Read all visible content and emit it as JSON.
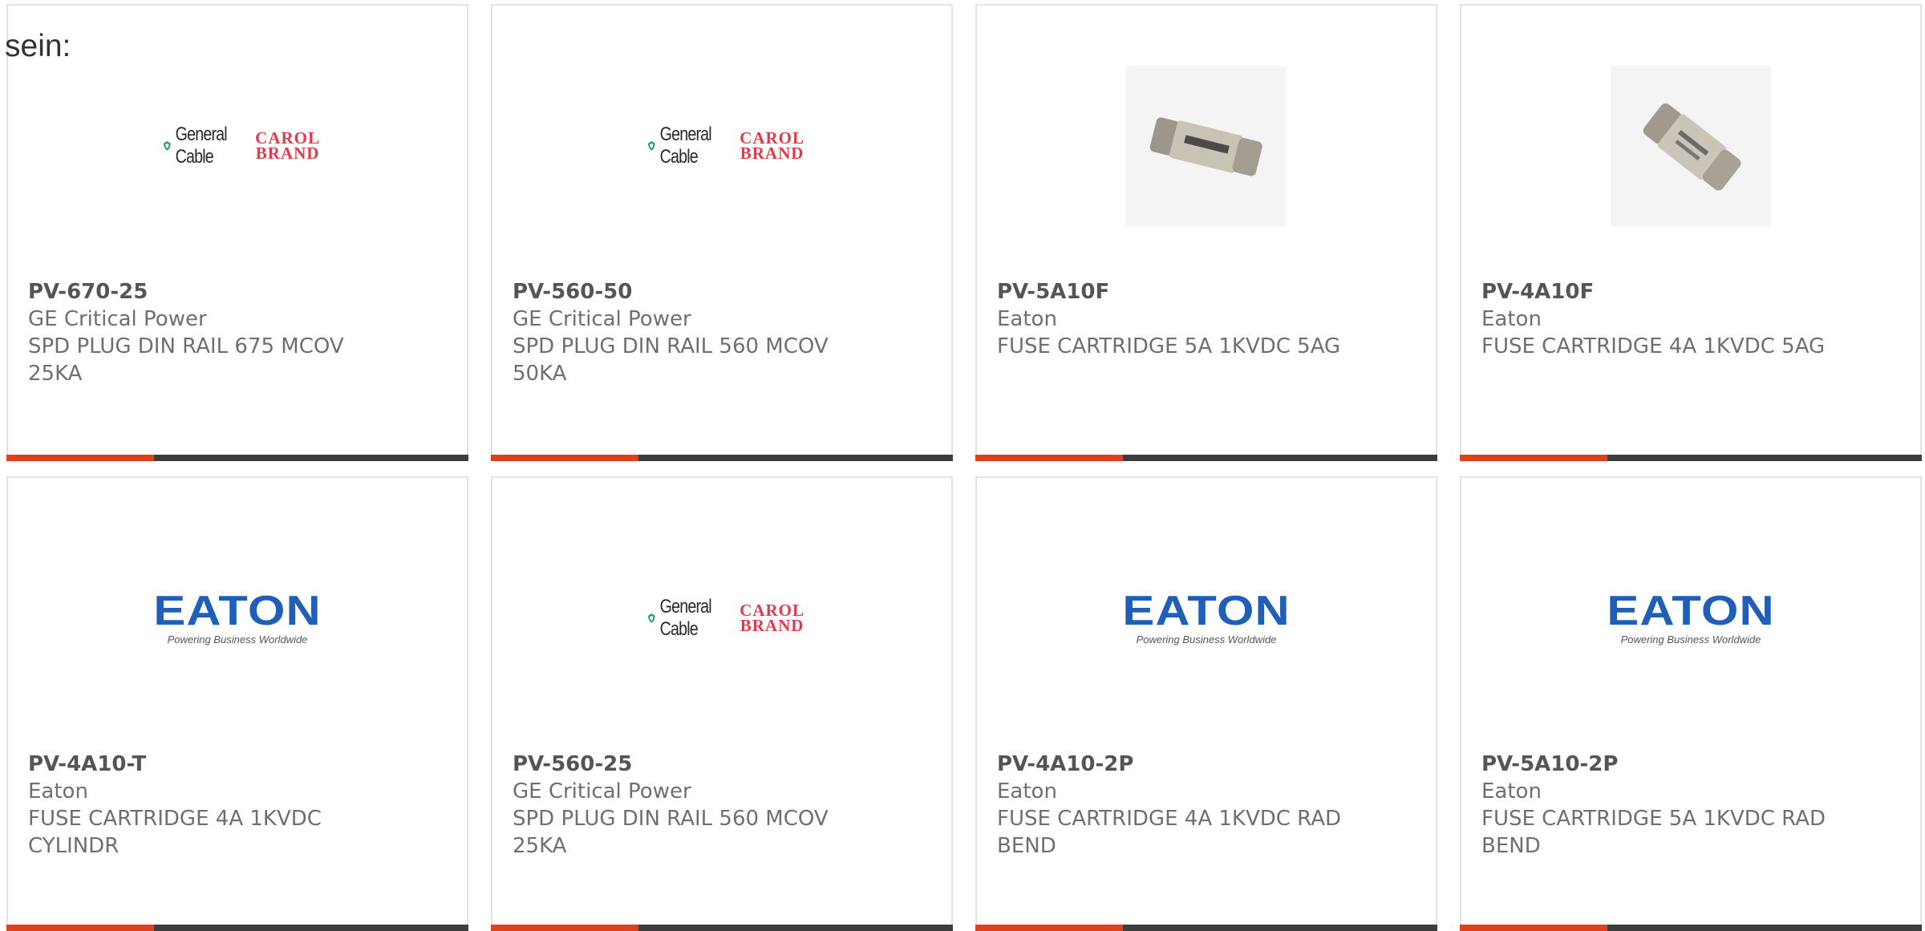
{
  "intro_text": "sein:",
  "colors": {
    "accent": "#e0401b",
    "bar": "#3d3d3d",
    "eaton_blue": "#1f5fb8",
    "carol_red": "#e23a4a"
  },
  "products": [
    {
      "part": "PV-670-25",
      "manufacturer": "GE Critical Power",
      "desc1": "SPD PLUG DIN RAIL 675 MCOV",
      "desc2": "25KA",
      "image": "general-cable-carol-logo",
      "logo_left": "General Cable",
      "logo_right1": "CAROL",
      "logo_right2": "BRAND"
    },
    {
      "part": "PV-560-50",
      "manufacturer": "GE Critical Power",
      "desc1": "SPD PLUG DIN RAIL 560 MCOV",
      "desc2": "50KA",
      "image": "general-cable-carol-logo",
      "logo_left": "General Cable",
      "logo_right1": "CAROL",
      "logo_right2": "BRAND"
    },
    {
      "part": "PV-5A10F",
      "manufacturer": "Eaton",
      "desc1": "FUSE CARTRIDGE 5A 1KVDC 5AG",
      "desc2": "",
      "image": "fuse-cartridge-photo"
    },
    {
      "part": "PV-4A10F",
      "manufacturer": "Eaton",
      "desc1": "FUSE CARTRIDGE 4A 1KVDC 5AG",
      "desc2": "",
      "image": "fuse-cartridge-photo"
    },
    {
      "part": "PV-4A10-T",
      "manufacturer": "Eaton",
      "desc1": "FUSE CARTRIDGE 4A 1KVDC",
      "desc2": "CYLINDR",
      "image": "eaton-logo",
      "logo_word": "EATON",
      "logo_tag": "Powering Business Worldwide"
    },
    {
      "part": "PV-560-25",
      "manufacturer": "GE Critical Power",
      "desc1": "SPD PLUG DIN RAIL 560 MCOV",
      "desc2": "25KA",
      "image": "general-cable-carol-logo",
      "logo_left": "General Cable",
      "logo_right1": "CAROL",
      "logo_right2": "BRAND"
    },
    {
      "part": "PV-4A10-2P",
      "manufacturer": "Eaton",
      "desc1": "FUSE CARTRIDGE 4A 1KVDC RAD",
      "desc2": "BEND",
      "image": "eaton-logo",
      "logo_word": "EATON",
      "logo_tag": "Powering Business Worldwide"
    },
    {
      "part": "PV-5A10-2P",
      "manufacturer": "Eaton",
      "desc1": "FUSE CARTRIDGE 5A 1KVDC RAD",
      "desc2": "BEND",
      "image": "eaton-logo",
      "logo_word": "EATON",
      "logo_tag": "Powering Business Worldwide"
    }
  ]
}
